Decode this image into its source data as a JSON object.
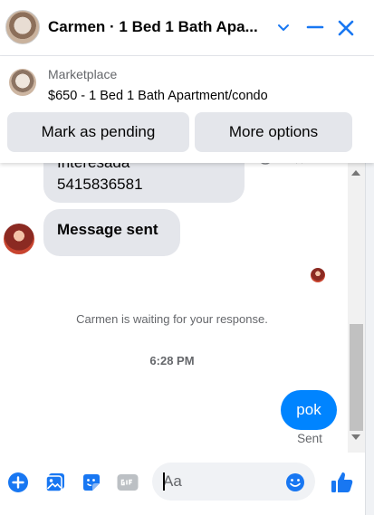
{
  "header": {
    "title": "Carmen · 1 Bed 1 Bath Apa...",
    "accent": "#1877f2"
  },
  "listing": {
    "source": "Marketplace",
    "description": "$650 - 1 Bed 1 Bath Apartment/condo",
    "pending_label": "Mark as pending",
    "more_label": "More options"
  },
  "messages": {
    "partial_line1": "Interesada",
    "partial_line2": "5415836581",
    "sent_text": "Message sent",
    "waiting_text": "Carmen is waiting for your response.",
    "timestamp": "6:28 PM",
    "own_text": "pok",
    "status": "Sent",
    "own_bubble_color": "#0084ff"
  },
  "composer": {
    "placeholder": "Aa",
    "icons": [
      "plus-circle-icon",
      "image-icon",
      "sticker-icon",
      "gif-icon",
      "emoji-icon",
      "like-icon"
    ]
  }
}
